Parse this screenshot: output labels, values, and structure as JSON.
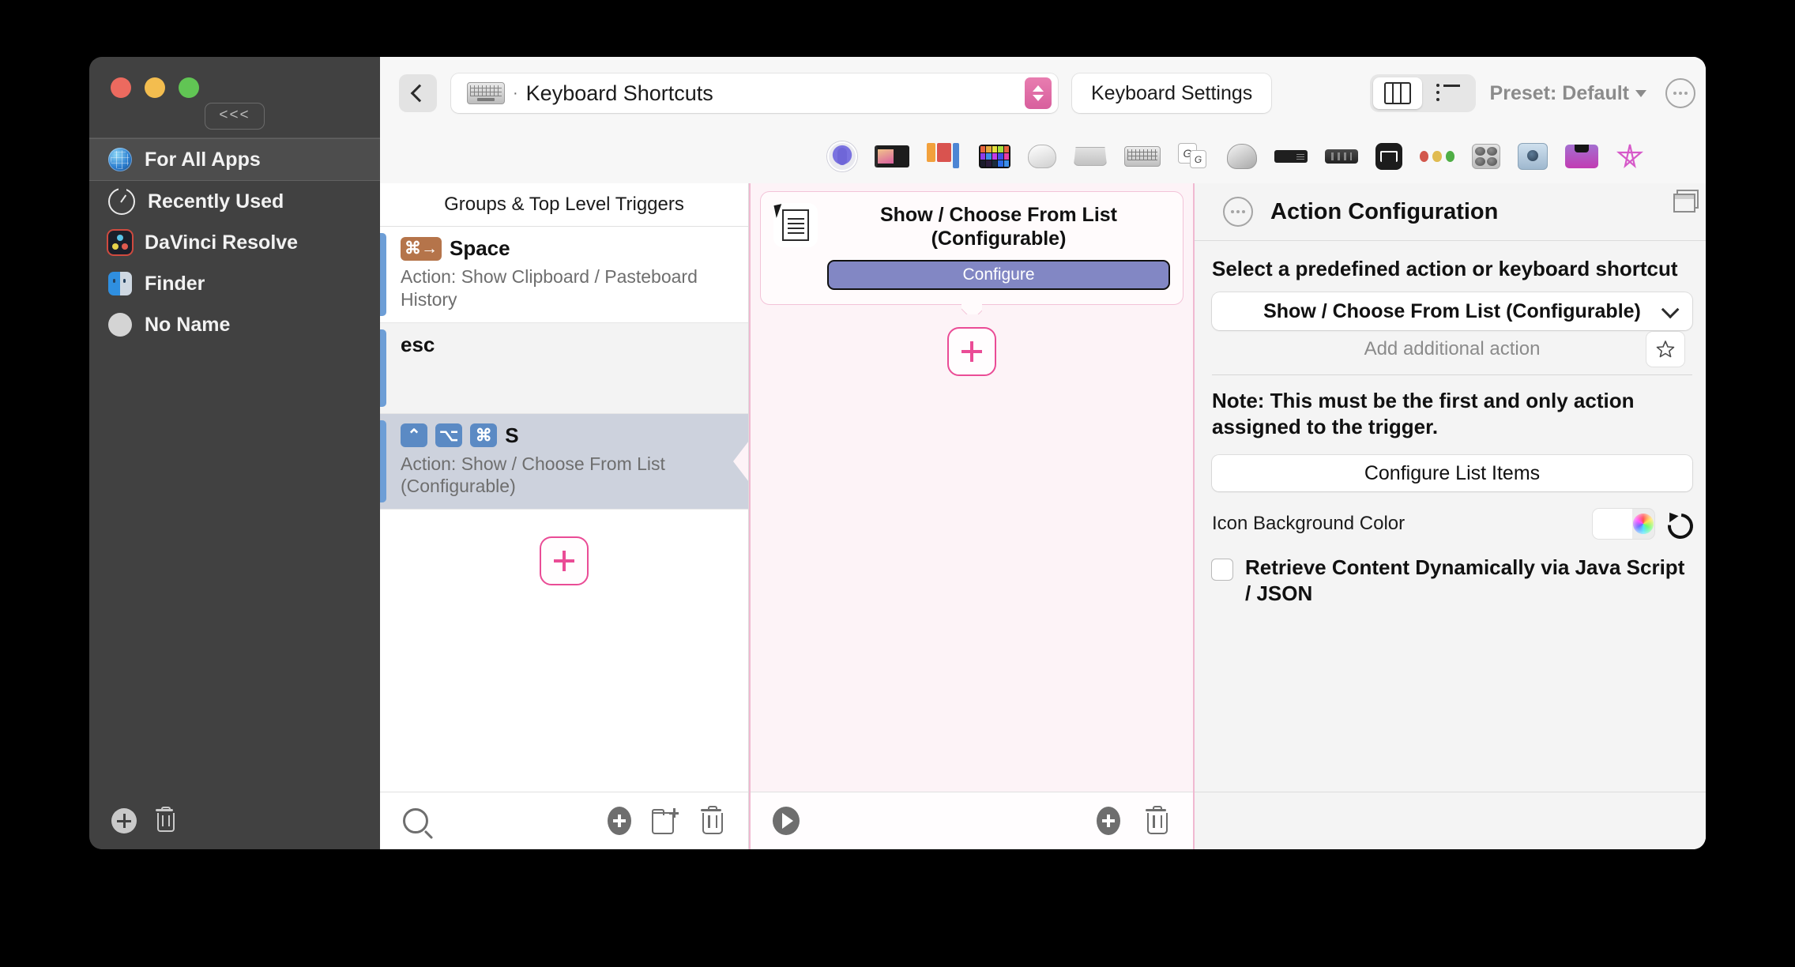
{
  "sidebar": {
    "collapse_label": "<<<",
    "items": [
      {
        "label": "For All Apps",
        "icon": "globe-icon",
        "selected": true
      },
      {
        "label": "Recently Used",
        "icon": "clock-icon",
        "selected": false
      },
      {
        "label": "DaVinci Resolve",
        "icon": "davinci-resolve-icon",
        "selected": false
      },
      {
        "label": "Finder",
        "icon": "finder-icon",
        "selected": false
      },
      {
        "label": "No Name",
        "icon": "circle-icon",
        "selected": false
      }
    ],
    "footer": {
      "add_label": "+",
      "delete_icon": "trash-icon"
    }
  },
  "toolbar": {
    "back_icon": "chevron-left-icon",
    "path_icon": "keyboard-icon",
    "path_separator": "·",
    "path_title": "Keyboard Shortcuts",
    "stepper_icon": "stepper-up-down-icon",
    "keyboard_settings_label": "Keyboard Settings",
    "view_modes": [
      {
        "name": "columns-view",
        "icon": "columns-icon",
        "active": true
      },
      {
        "name": "list-view",
        "icon": "list-icon",
        "active": false
      }
    ],
    "preset_label": "Preset: Default",
    "preset_caret": "▾",
    "more_icon": "ellipsis-circle-icon"
  },
  "trigger_type_icons": [
    "bettertouchtool-icon",
    "touchbar-icon",
    "stream-deck-icon",
    "grid-icon",
    "magic-mouse-icon",
    "trackpad-icon",
    "keyboard-icon",
    "key-sequence-icon",
    "normal-mouse-icon",
    "remote-strip-icon",
    "siri-remote-icon",
    "drawing-icon",
    "traffic-light-icon",
    "knobs-icon",
    "midi-icon",
    "stream-deck-plus-icon",
    "star-gesture-icon"
  ],
  "groups_pane": {
    "header": "Groups & Top Level Triggers",
    "rows": [
      {
        "keys": [
          {
            "glyph": "⌘→",
            "color": "brown"
          }
        ],
        "title": "Space",
        "subtitle": "Action: Show Clipboard / Pasteboard History",
        "selected": false
      },
      {
        "keys": [],
        "title": "esc",
        "subtitle": "",
        "selected": false
      },
      {
        "keys": [
          {
            "glyph": "⌃",
            "color": "blue"
          },
          {
            "glyph": "⌥",
            "color": "blue"
          },
          {
            "glyph": "⌘",
            "color": "blue"
          }
        ],
        "title": "S",
        "subtitle": "Action: Show / Choose From List (Configurable)",
        "selected": true
      }
    ],
    "footer_icons": [
      "search-icon",
      "add-icon",
      "new-folder-icon",
      "trash-icon"
    ]
  },
  "actions_pane": {
    "card": {
      "icon": "choose-from-list-icon",
      "title": "Show / Choose From List (Configurable)",
      "configure_label": "Configure"
    },
    "add_action_icon": "add-action-icon",
    "footer_icons": [
      "play-icon",
      "add-icon",
      "trash-icon"
    ]
  },
  "config_pane": {
    "header_icon": "ellipsis-circle-icon",
    "header_title": "Action Configuration",
    "window_icon": "detach-window-icon",
    "select_label": "Select a predefined action or keyboard shortcut",
    "selected_action": "Show / Choose From List (Configurable)",
    "select_caret": "chevron-down-icon",
    "add_additional_action": "Add additional action",
    "favorite_icon": "star-icon",
    "note": "Note: This must be the first and only action assigned to the trigger.",
    "configure_list_items_label": "Configure List Items",
    "icon_background_color_label": "Icon Background Color",
    "icon_background_color_value": "#ffffff",
    "color_wheel_icon": "color-wheel-icon",
    "reset_icon": "reset-icon",
    "retrieve_dynamically_label": "Retrieve Content Dynamically via Java Script / JSON",
    "retrieve_dynamically_checked": false
  },
  "colors": {
    "accent_pink": "#ea4c96",
    "stepper_pink": "#d85f9d",
    "configure_purple": "#8287c4",
    "group_bar_blue": "#6d9ed6",
    "selected_row": "#cdd2dd",
    "sidebar_bg": "#414141"
  }
}
